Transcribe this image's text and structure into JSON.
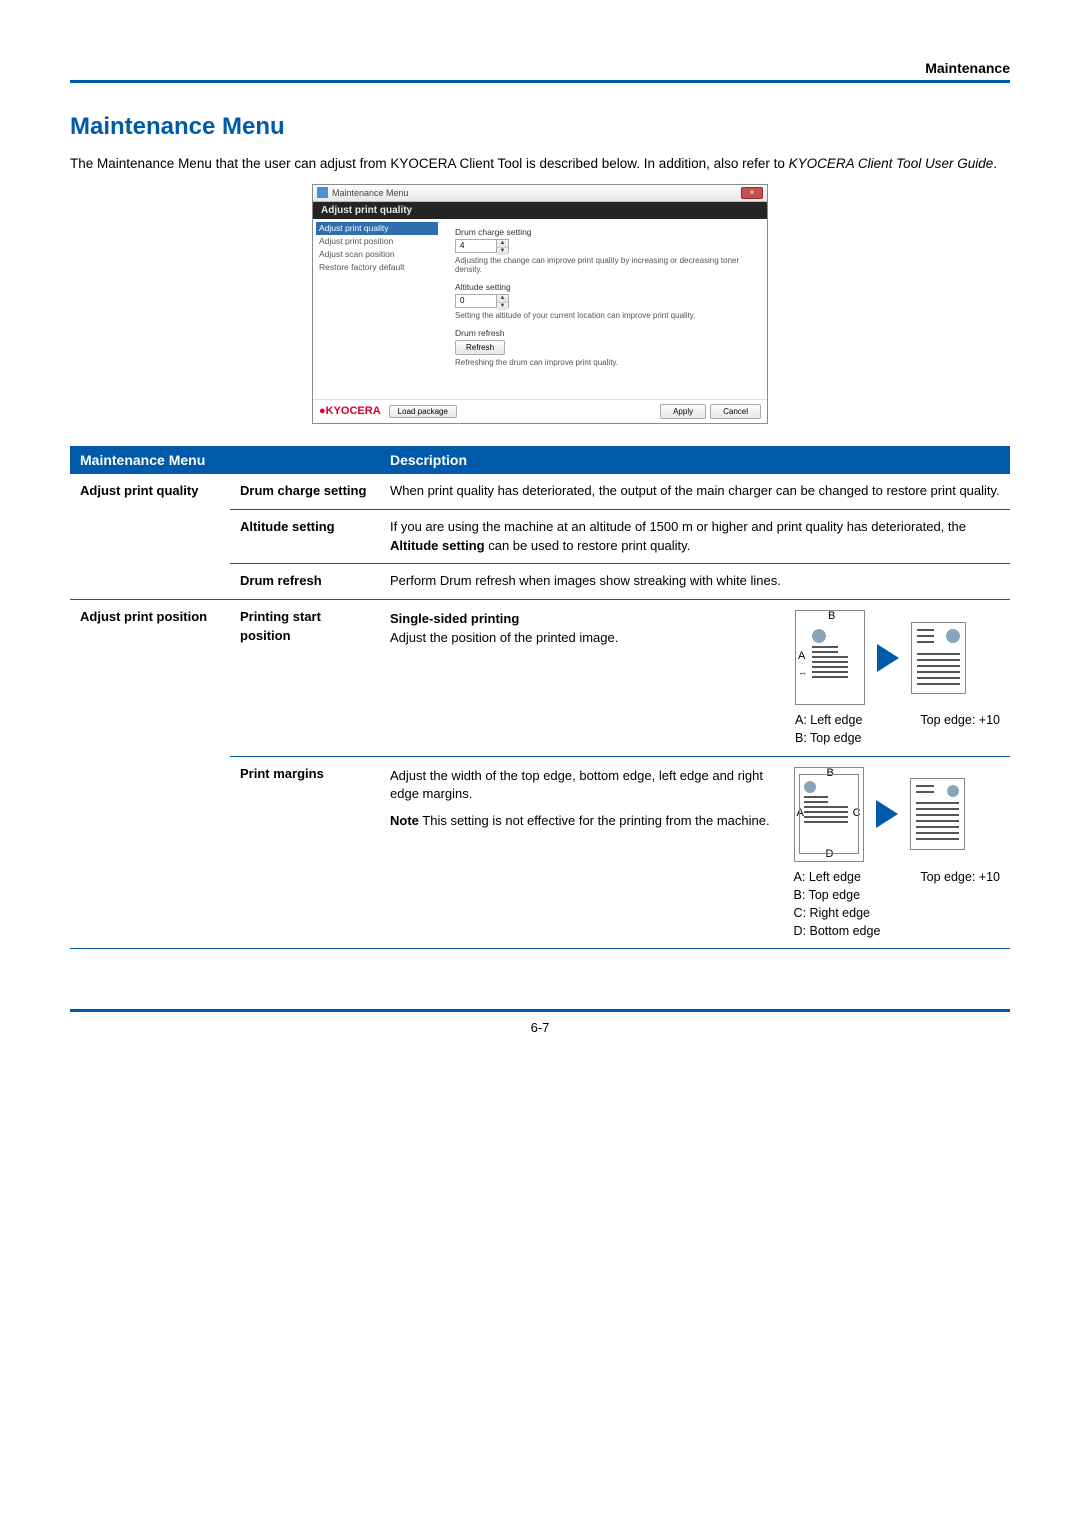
{
  "header": {
    "section": "Maintenance"
  },
  "heading": "Maintenance Menu",
  "intro": {
    "line1": "The Maintenance Menu that the user can adjust from KYOCERA Client Tool is described below. In addition, also refer to ",
    "line2_em": "KYOCERA Client Tool User Guide",
    "line2_end": "."
  },
  "dialog": {
    "window_title": "Maintenance Menu",
    "subtitle": "Adjust print quality",
    "sidebar": {
      "item0": "Adjust print quality",
      "item1": "Adjust print position",
      "item2": "Adjust scan position",
      "item3": "Restore factory default"
    },
    "drum_charge": {
      "label": "Drum charge setting",
      "value": "4",
      "help": "Adjusting the change can improve print quality by increasing or decreasing toner density."
    },
    "altitude": {
      "label": "Altitude setting",
      "value": "0",
      "help": "Setting the altitude of your current location can improve print quality."
    },
    "drum_refresh": {
      "label": "Drum refresh",
      "button": "Refresh",
      "help": "Refreshing the drum can improve print quality."
    },
    "footer": {
      "logo": "KYOCERA",
      "load_pkg": "Load package",
      "apply": "Apply",
      "cancel": "Cancel"
    }
  },
  "table": {
    "th_menu": "Maintenance Menu",
    "th_desc": "Description",
    "r1": {
      "a": "Adjust print quality",
      "b1": "Drum charge setting",
      "d1": "When print quality has deteriorated, the output of the main charger can be changed to restore print quality.",
      "b2": "Altitude setting",
      "d2_pre": "If you are using the machine at an altitude of 1500 m or higher and print quality has deteriorated, the ",
      "d2_bold": "Altitude setting",
      "d2_post": " can be used to restore print quality.",
      "b3": "Drum refresh",
      "d3": "Perform Drum refresh when images show streaking with white lines."
    },
    "r2": {
      "a": "Adjust print position",
      "b1": "Printing start position",
      "d1_title": "Single-sided printing",
      "d1_text": "Adjust the position of the printed image.",
      "d1_caption_left_a": "A: Left edge",
      "d1_caption_left_b": "B: Top edge",
      "d1_caption_right": "Top edge: +10",
      "b2": "Print margins",
      "d2_line1": "Adjust the width of the top edge, bottom edge, left edge and right edge margins.",
      "d2_note_bold": "Note",
      "d2_note_text": "  This setting is not effective for the printing from the machine.",
      "d2_caption_a": "A: Left edge",
      "d2_caption_b": "B: Top edge",
      "d2_caption_c": "C: Right edge",
      "d2_caption_d": "D: Bottom edge",
      "d2_caption_right": "Top edge: +10"
    }
  },
  "footer": {
    "page_no": "6-7"
  }
}
